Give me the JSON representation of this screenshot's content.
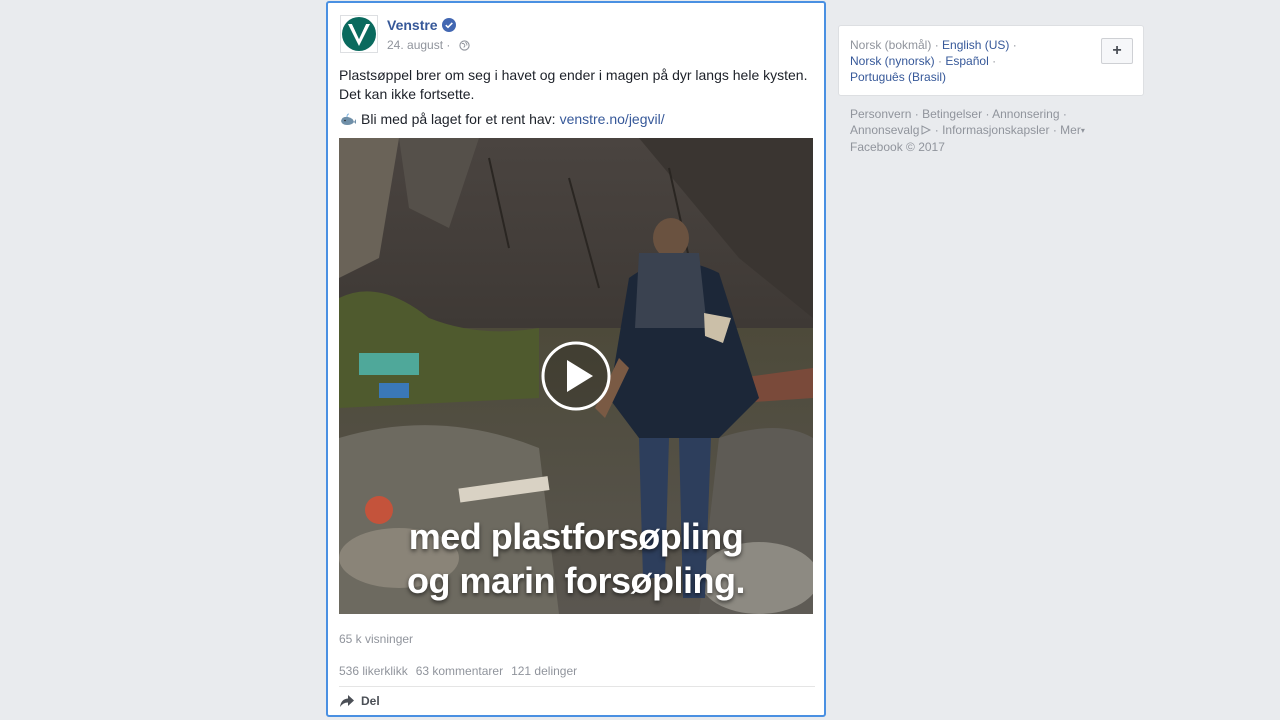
{
  "post": {
    "page_name": "Venstre",
    "verified_icon": "verified-badge-icon",
    "date": "24. august",
    "meta_separator": " · ",
    "privacy_icon": "globe-icon",
    "text": "Plastsøppel brer om seg i havet og ender i magen på dyr langs hele kysten. Det kan ikke fortsette.",
    "cta_icon": "whale-icon",
    "cta_text": "Bli med på laget for et rent hav:",
    "cta_link": "venstre.no/jegvil/",
    "video": {
      "caption_line1": "med plastforsøpling",
      "caption_line2": "og marin forsøpling.",
      "play_icon": "play-icon"
    },
    "views": "65 k visninger",
    "stats": {
      "likes": "536 likerklikk",
      "comments": "63 kommentarer",
      "shares": "121 delinger"
    },
    "share_label": "Del"
  },
  "languages": {
    "current": "Norsk (bokmål)",
    "options": [
      "English (US)",
      "Norsk (nynorsk)",
      "Español",
      "Português (Brasil)"
    ],
    "add_button": "+"
  },
  "footer": {
    "links": [
      "Personvern",
      "Betingelser",
      "Annonsering",
      "Annonsevalg",
      "Informasjonskapsler",
      "Mer"
    ],
    "copyright": "Facebook © 2017"
  },
  "colors": {
    "link": "#365899",
    "muted": "#90949c",
    "focus_border": "#4a90e2",
    "logo_green": "#0a6a5e"
  }
}
